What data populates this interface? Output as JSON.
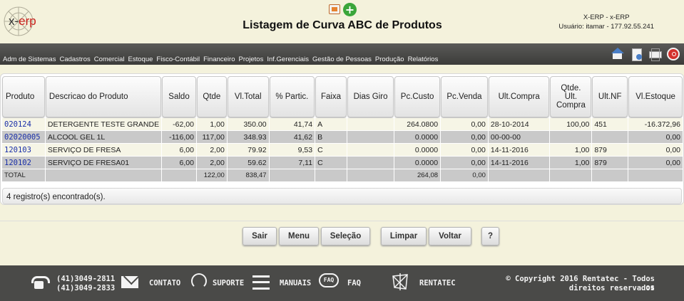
{
  "header": {
    "logo_text_a": "x-",
    "logo_text_b": "erp",
    "title": "Listagem de Curva ABC de Produtos",
    "sys_name": "X-ERP - x-ERP",
    "user_info": "Usuário: itamar - 177.92.55.241"
  },
  "menu": [
    "Adm de Sistemas",
    "Cadastros",
    "Comercial",
    "Estoque",
    "Fisco-Contábil",
    "Financeiro",
    "Projetos",
    "Inf.Gerenciais",
    "Gestão de Pessoas",
    "Produção",
    "Relatórios"
  ],
  "toolbar_icons": [
    "home-icon",
    "document-icon",
    "printer-icon",
    "exit-icon"
  ],
  "table": {
    "columns": [
      "Produto",
      "Descricao do Produto",
      "Saldo",
      "Qtde",
      "Vl.Total",
      "% Partic.",
      "Faixa",
      "Dias Giro",
      "Pc.Custo",
      "Pc.Venda",
      "Ult.Compra",
      "Qtde. Ult. Compra",
      "Ult.NF",
      "Vl.Estoque"
    ],
    "rows": [
      [
        "020124",
        "DETERGENTE TESTE GRANDE",
        "-62,00",
        "1,00",
        "350.00",
        "41,74",
        "A",
        "",
        "264.0800",
        "0,00",
        "28-10-2014",
        "100,00",
        "451",
        "-16.372,96"
      ],
      [
        "02020005",
        "ALCOOL GEL 1L",
        "-116,00",
        "117,00",
        "348.93",
        "41,62",
        "B",
        "",
        "0.0000",
        "0,00",
        "00-00-00",
        "",
        "",
        "0,00"
      ],
      [
        "120103",
        "SERVIÇO DE FRESA",
        "6,00",
        "2,00",
        "79.92",
        "9,53",
        "C",
        "",
        "0.0000",
        "0,00",
        "14-11-2016",
        "1,00",
        "879",
        "0,00"
      ],
      [
        "120102",
        "SERVIÇO DE FRESA01",
        "6,00",
        "2,00",
        "59.62",
        "7,11",
        "C",
        "",
        "0.0000",
        "0,00",
        "14-11-2016",
        "1,00",
        "879",
        "0,00"
      ]
    ],
    "total": [
      "TOTAL",
      "",
      "",
      "122,00",
      "838,47",
      "",
      "",
      "",
      "264,08",
      "0,00",
      "",
      "",
      "",
      ""
    ],
    "count_text": "4 registro(s) encontrado(s)."
  },
  "buttons": {
    "sair": "Sair",
    "menu": "Menu",
    "selecao": "Seleção",
    "limpar": "Limpar",
    "voltar": "Voltar",
    "help": "?"
  },
  "footer": {
    "phone1": "(41)3049-2811",
    "phone2": "(41)3049-2833",
    "contato": "CONTATO",
    "suporte": "SUPORTE",
    "manuais": "MANUAIS",
    "faq": "FAQ",
    "faq_icon_text": "FAQ",
    "rentatec": "RENTATEC",
    "copyright1": "© Copyright 2016 Rentatec - Todos os",
    "copyright2": "direitos reservados"
  },
  "colors": {
    "background": "#f4f2dc",
    "menubar": "#4a4a48",
    "code_link": "#1a2fa8",
    "accent_red": "#c8201b"
  }
}
